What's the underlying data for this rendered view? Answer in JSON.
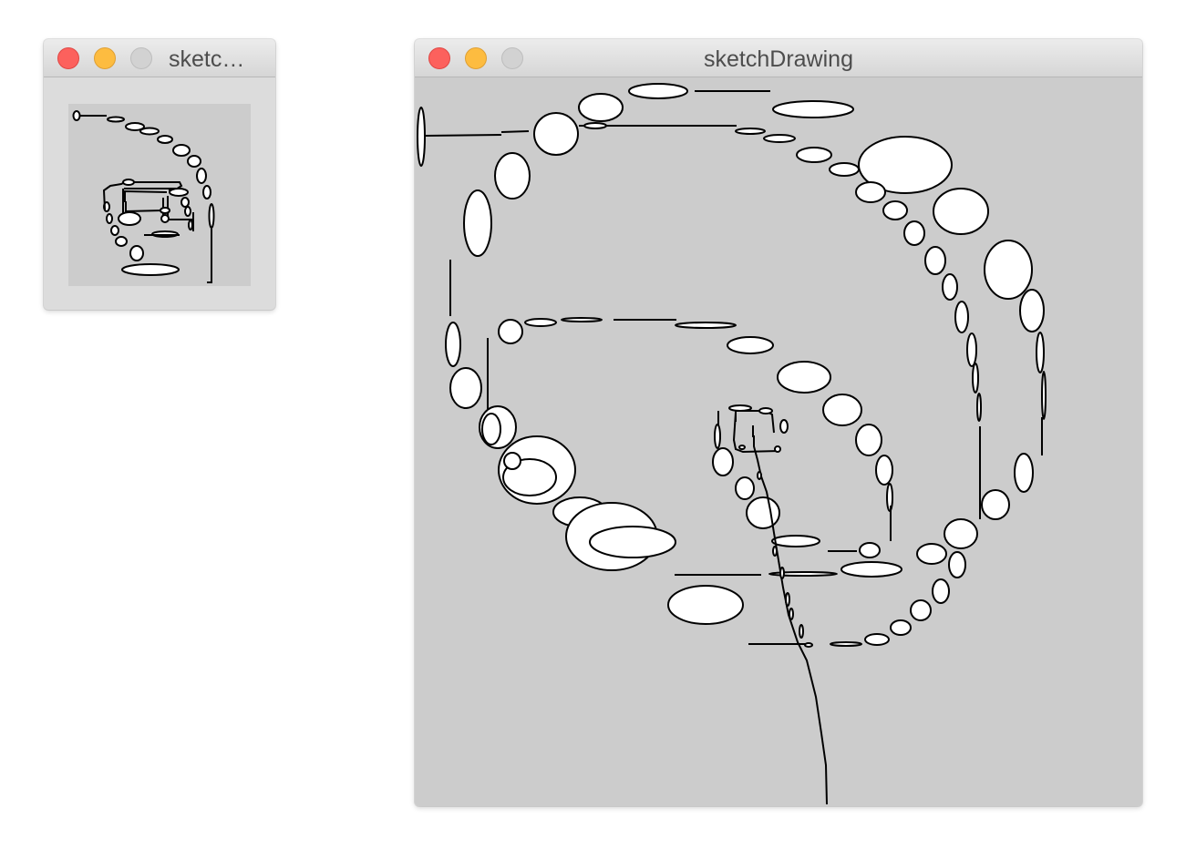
{
  "windows": [
    {
      "title": "sketc…",
      "canvas_color": "#cccccc",
      "frame_color": "#dcdcdc"
    },
    {
      "title": "sketchDrawing",
      "canvas_color": "#cccccc"
    }
  ],
  "traffic_light_colors": {
    "close": "#fc615d",
    "minimize": "#fdbc40",
    "zoom": "#d2d2d2"
  }
}
